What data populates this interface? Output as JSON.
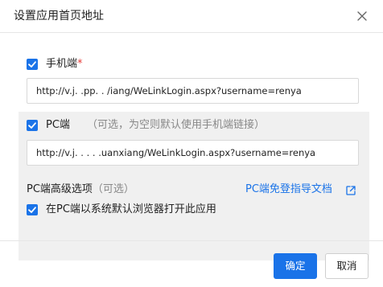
{
  "dialog": {
    "title": "设置应用首页地址"
  },
  "mobile": {
    "label": "手机端",
    "required_mark": "*",
    "checked": true,
    "url_value": "http://v.j.        .pp.       .    /iang/WeLinkLogin.aspx?username=renya"
  },
  "pc": {
    "label": "PC端",
    "hint": "（可选，为空则默认使用手机端链接）",
    "checked": true,
    "url_value": "http://v.j.        .    .    .    .uanxiang/WeLinkLogin.aspx?username=renya",
    "advanced_label": "PC端高级选项",
    "advanced_hint": "（可选）",
    "guide_link": "PC端免登指导文档",
    "open_default_browser_label": "在PC端以系统默认浏览器打开此应用",
    "open_default_browser_checked": true
  },
  "footer": {
    "confirm_label": "确定",
    "cancel_label": "取消"
  },
  "colors": {
    "accent": "#1a73e8",
    "required": "#e53935",
    "section_bg": "#f0f0f0"
  }
}
